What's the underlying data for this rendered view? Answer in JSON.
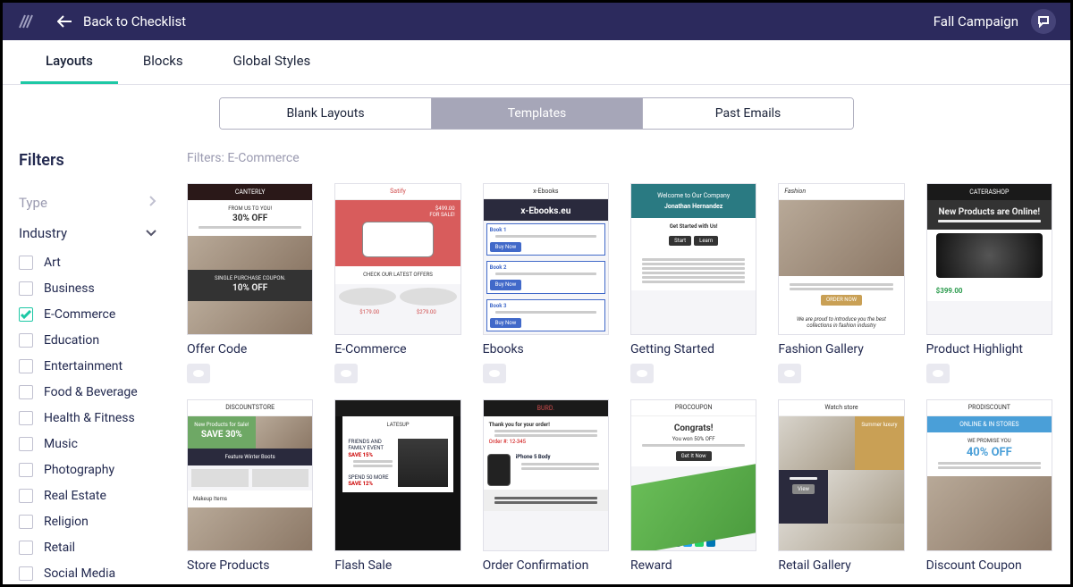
{
  "topbar": {
    "back_label": "Back to Checklist",
    "campaign": "Fall Campaign"
  },
  "tabs": [
    {
      "label": "Layouts",
      "active": true
    },
    {
      "label": "Blocks",
      "active": false
    },
    {
      "label": "Global Styles",
      "active": false
    }
  ],
  "segments": [
    {
      "label": "Blank Layouts",
      "active": false
    },
    {
      "label": "Templates",
      "active": true
    },
    {
      "label": "Past Emails",
      "active": false
    }
  ],
  "sidebar": {
    "heading": "Filters",
    "groups": [
      {
        "label": "Type",
        "expanded": false
      },
      {
        "label": "Industry",
        "expanded": true
      }
    ],
    "industry_options": [
      {
        "label": "Art",
        "checked": false
      },
      {
        "label": "Business",
        "checked": false
      },
      {
        "label": "E-Commerce",
        "checked": true
      },
      {
        "label": "Education",
        "checked": false
      },
      {
        "label": "Entertainment",
        "checked": false
      },
      {
        "label": "Food & Beverage",
        "checked": false
      },
      {
        "label": "Health & Fitness",
        "checked": false
      },
      {
        "label": "Music",
        "checked": false
      },
      {
        "label": "Photography",
        "checked": false
      },
      {
        "label": "Real Estate",
        "checked": false
      },
      {
        "label": "Religion",
        "checked": false
      },
      {
        "label": "Retail",
        "checked": false
      },
      {
        "label": "Social Media",
        "checked": false
      }
    ]
  },
  "main": {
    "filter_summary": "Filters: E-Commerce",
    "templates": [
      {
        "title": "Offer Code",
        "thumb": {
          "brand": "CANTERLY",
          "big1": "30% OFF",
          "sub1": "FROM US TO YOU!",
          "mid": "SINGLE PURCHASE COUPON.",
          "big2": "10% OFF"
        }
      },
      {
        "title": "E-Commerce",
        "thumb": {
          "brand": "Satify",
          "price": "$499.00",
          "tag": "FOR SALE!",
          "mid": "CHECK OUR LATEST OFFERS",
          "p1": "$179.00",
          "p2": "$279.00"
        }
      },
      {
        "title": "Ebooks",
        "thumb": {
          "brand": "x-Ebooks",
          "big": "x-Ebooks.eu"
        }
      },
      {
        "title": "Getting Started",
        "thumb": {
          "head": "Welcome to Our Company",
          "name": "Jonathan Hernandez",
          "sub": "Get Started with Us!"
        }
      },
      {
        "title": "Fashion Gallery",
        "thumb": {
          "brand": "Fashion",
          "caption": "We are proud to introduce you the best collections in fashion industry"
        }
      },
      {
        "title": "Product Highlight",
        "thumb": {
          "brand": "CATERASHOP",
          "head": "New Products are Online!",
          "price": "$399.00"
        }
      },
      {
        "title": "Store Products",
        "thumb": {
          "brand": "DISCOUNTSTORE",
          "hl1": "New Products for Sale!",
          "hl2": "SAVE 30%",
          "mid": "Feature Winter Boots",
          "foot": "Makeup Items"
        }
      },
      {
        "title": "Flash Sale",
        "thumb": {
          "brand": "LATESUP",
          "l1": "FRIENDS AND FAMILY EVENT",
          "l2": "SAVE 15%",
          "l3": "SPEND 50 MORE",
          "l4": "SAVE 12%"
        }
      },
      {
        "title": "Order Confirmation",
        "thumb": {
          "brand": "BURD.",
          "line": "Thank you for your order!",
          "item": "iPhone 5 Body"
        }
      },
      {
        "title": "Reward",
        "thumb": {
          "brand": "PROCOUPON",
          "head": "Congrats!",
          "sub": "You won 50% OFF",
          "btn": "Get It Now"
        }
      },
      {
        "title": "Retail Gallery",
        "thumb": {
          "brand": "Watch store",
          "p1": "Summer luxury"
        }
      },
      {
        "title": "Discount Coupon",
        "thumb": {
          "brand": "PRODISCOUNT",
          "tag": "ONLINE & IN STORES",
          "line": "WE PROMISE YOU",
          "big": "40% OFF"
        }
      }
    ]
  }
}
